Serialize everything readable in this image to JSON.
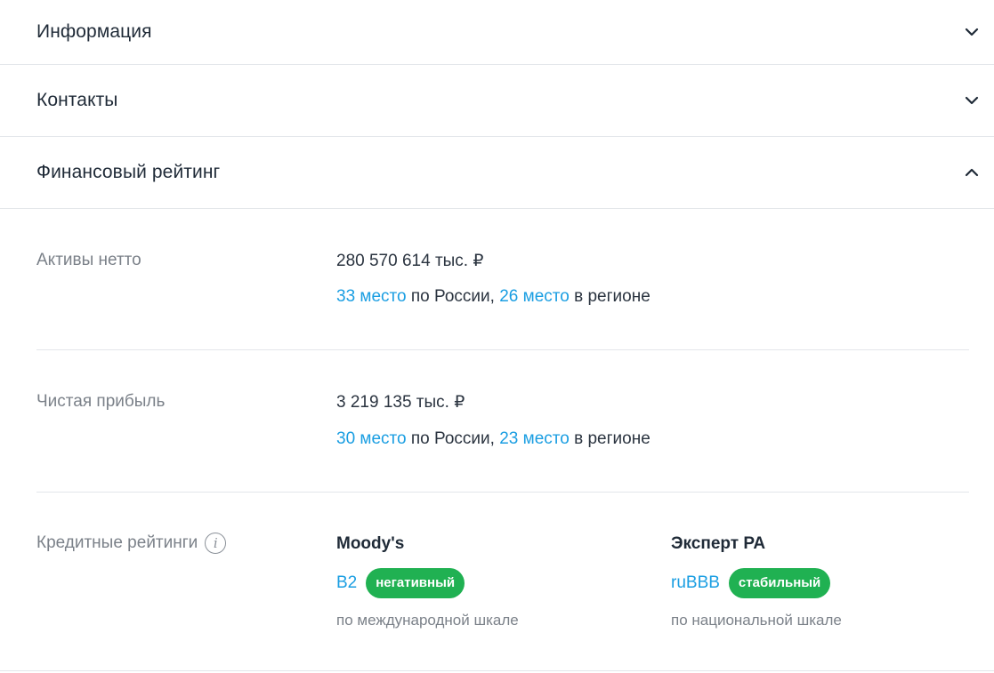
{
  "sections": {
    "info": {
      "title": "Информация"
    },
    "contacts": {
      "title": "Контакты"
    },
    "financial": {
      "title": "Финансовый рейтинг"
    }
  },
  "assets": {
    "label": "Активы нетто",
    "value": "280 570 614 тыс. ₽",
    "rank_country_link": "33 место",
    "rank_country_text": " по России, ",
    "rank_region_link": "26 место",
    "rank_region_text": " в регионе"
  },
  "profit": {
    "label": "Чистая прибыль",
    "value": "3 219 135 тыс. ₽",
    "rank_country_link": "30 место",
    "rank_country_text": " по России, ",
    "rank_region_link": "23 место",
    "rank_region_text": " в регионе"
  },
  "credit": {
    "label": "Кредитные рейтинги",
    "info_glyph": "i",
    "agencies": [
      {
        "name": "Moody's",
        "code": "B2",
        "outlook": "негативный",
        "scale": "по международной шкале"
      },
      {
        "name": "Эксперт РА",
        "code": "ruBBB",
        "outlook": "стабильный",
        "scale": "по национальной шкале"
      }
    ]
  },
  "colors": {
    "link": "#1a9ee2",
    "badge": "#20b152",
    "divider": "#e3e6ea"
  },
  "icons": {
    "collapsed": "chevron-down-icon",
    "expanded": "chevron-up-icon",
    "info": "info-icon"
  }
}
